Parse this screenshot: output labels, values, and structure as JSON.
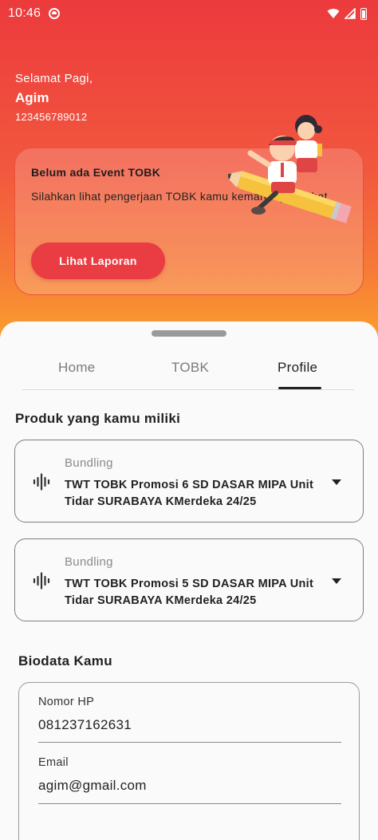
{
  "status_bar": {
    "time": "10:46"
  },
  "greeting": {
    "salutation": "Selamat Pagi,",
    "name": "Agim",
    "id_number": "123456789012"
  },
  "event_card": {
    "title": "Belum ada Event TOBK",
    "description": "Silahkan lihat pengerjaan TOBK kamu kemaren ya, sobat",
    "button_label": "Lihat Laporan"
  },
  "tabs": [
    {
      "label": "Home",
      "active": false
    },
    {
      "label": "TOBK",
      "active": false
    },
    {
      "label": "Profile",
      "active": true
    }
  ],
  "products": {
    "title": "Produk yang kamu miliki",
    "items": [
      {
        "label": "Bundling",
        "value": "TWT TOBK Promosi 6 SD DASAR MIPA Unit Tidar SURABAYA KMerdeka 24/25",
        "icon": "audio-waveform-icon"
      },
      {
        "label": "Bundling",
        "value": "TWT TOBK Promosi 5 SD DASAR MIPA Unit Tidar SURABAYA KMerdeka 24/25",
        "icon": "audio-waveform-icon"
      }
    ]
  },
  "biodata": {
    "title": "Biodata Kamu",
    "fields": [
      {
        "label": "Nomor HP",
        "value": "081237162631"
      },
      {
        "label": "Email",
        "value": "agim@gmail.com"
      }
    ]
  },
  "colors": {
    "primary": "#ea3d43",
    "gradient_top": "#ec3a3d",
    "gradient_bottom": "#fba52c",
    "sheet": "#fafafa"
  }
}
